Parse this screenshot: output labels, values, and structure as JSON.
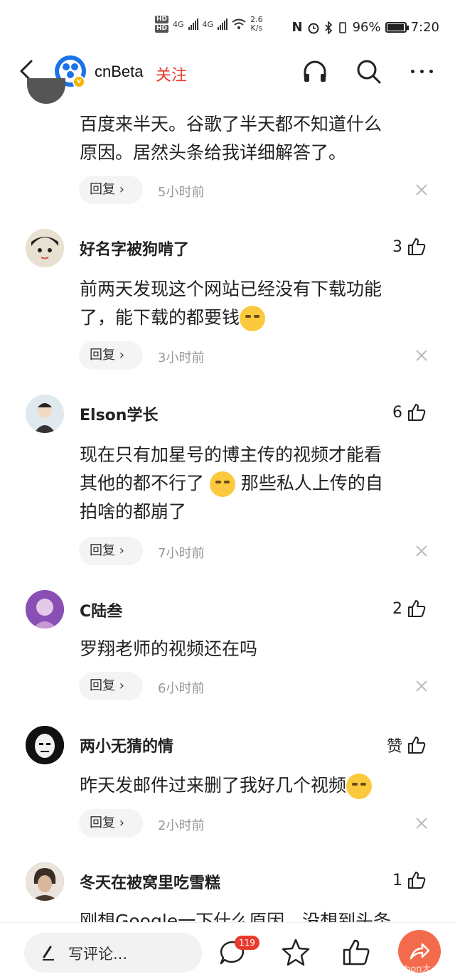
{
  "status_bar": {
    "hd1": "HD",
    "hd2": "HD",
    "net1": "4G",
    "net2": "4G",
    "speed_value": "2.6",
    "speed_unit": "K/s",
    "battery_percent": "96%",
    "battery_level": 0.96,
    "time": "7:20"
  },
  "header": {
    "title": "cnBeta",
    "follow_label": "关注",
    "badge": "v"
  },
  "comments": [
    {
      "text": [
        "百度来半天。谷歌了半天都不知道什么",
        "原因。居然头条给我详细解答了。"
      ],
      "reply_label": "回复 ›",
      "time": "5小时前"
    },
    {
      "username": "好名字被狗啃了",
      "likes": "3",
      "text": [
        "前两天发现这个网站已经没有下载功能",
        "了，能下载的都要钱"
      ],
      "reply_label": "回复 ›",
      "time": "3小时前"
    },
    {
      "username": "Elson学长",
      "likes": "6",
      "text": [
        "现在只有加星号的博主传的视频才能看",
        "其他的都不行了",
        "那些私人上传的自",
        "拍啥的都崩了"
      ],
      "reply_label": "回复 ›",
      "time": "7小时前"
    },
    {
      "username": "C陆叁",
      "likes": "2",
      "text": [
        "罗翔老师的视频还在吗"
      ],
      "reply_label": "回复 ›",
      "time": "6小时前"
    },
    {
      "username": "两小无猜的情",
      "likes": "赞",
      "text": [
        "昨天发邮件过来删了我好几个视频"
      ],
      "reply_label": "回复 ›",
      "time": "2小时前"
    },
    {
      "username": "冬天在被窝里吃雪糕",
      "likes": "1",
      "text": [
        "刚想Google一下什么原因，没想到头条"
      ]
    }
  ],
  "bottom_bar": {
    "input_placeholder": "写评论...",
    "comment_count": "119",
    "watermark": "thon大"
  }
}
